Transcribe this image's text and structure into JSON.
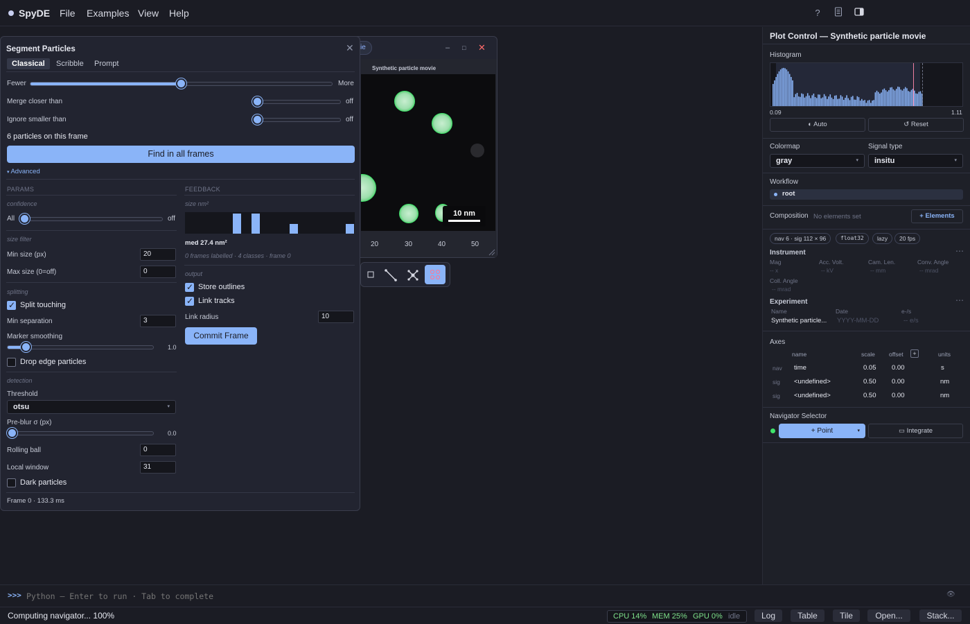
{
  "app": {
    "name": "SpyDE"
  },
  "menu": {
    "file": "File",
    "examples": "Examples",
    "view": "View",
    "help": "Help"
  },
  "topbar_icons": [
    "help-icon",
    "document-icon",
    "panel-toggle-icon"
  ],
  "plot_window": {
    "tab_label": "ie",
    "plot_title": "Synthetic particle movie",
    "scalebar_label": "10 nm",
    "x_ticks": [
      "20",
      "30",
      "40",
      "50"
    ],
    "minimize": "–",
    "maximize": "□",
    "close": "✕"
  },
  "plot_toolbar": {
    "tools": [
      "rectangle-tool-icon",
      "line-tool-icon",
      "move-points-tool-icon",
      "segment-tool-icon"
    ],
    "active": "segment-tool-icon"
  },
  "segment": {
    "title": "Segment Particles",
    "tabs": [
      {
        "label": "Classical",
        "active": true
      },
      {
        "label": "Scribble"
      },
      {
        "label": "Prompt"
      }
    ],
    "fewer": "Fewer",
    "more": "More",
    "sensitivity": 0.5,
    "merge_label": "Merge closer than",
    "merge_value": "off",
    "ignore_label": "Ignore smaller than",
    "ignore_value": "off",
    "particle_count": "6 particles on this frame",
    "find_all": "Find in all frames",
    "advanced": "Advanced",
    "params_head": "PARAMS",
    "feedback_head": "FEEDBACK",
    "confidence": {
      "label": "confidence",
      "min_label": "All",
      "value": "off"
    },
    "size_filter": {
      "label": "size filter",
      "min_label": "Min size (px)",
      "min_value": "20",
      "max_label": "Max size (0=off)",
      "max_value": "0"
    },
    "splitting": {
      "label": "splitting",
      "split_touching": "Split touching",
      "split_checked": true,
      "min_sep_label": "Min separation",
      "min_sep_value": "3",
      "marker_label": "Marker smoothing",
      "marker_value": "1.0",
      "drop_edge": "Drop edge particles",
      "drop_checked": false
    },
    "detection": {
      "label": "detection",
      "threshold_label": "Threshold",
      "threshold_value": "otsu",
      "preblur_label": "Pre-blur σ (px)",
      "preblur_value": "0.0",
      "rolling_label": "Rolling ball",
      "rolling_value": "0",
      "local_label": "Local window",
      "local_value": "31",
      "dark_label": "Dark particles",
      "dark_checked": false
    },
    "feedback": {
      "size_label": "size nm²",
      "histogram_bars": [
        0.95,
        0.95,
        0.45,
        0.45
      ],
      "median": "med 27.4 nm²",
      "summary": "0 frames labelled · 4 classes · frame 0",
      "output_label": "output",
      "store_outlines": "Store outlines",
      "link_tracks": "Link tracks",
      "link_radius_label": "Link radius",
      "link_radius_value": "10",
      "commit": "Commit Frame"
    },
    "frame_info": "Frame 0 · 133.3 ms"
  },
  "right_panel": {
    "title": "Plot Control — Synthetic particle movie",
    "histogram_label": "Histogram",
    "hist_min": "0.09",
    "hist_max": "1.11",
    "auto": "Auto",
    "reset": "Reset",
    "colormap_label": "Colormap",
    "colormap_value": "gray",
    "signal_label": "Signal type",
    "signal_value": "insitu",
    "workflow_label": "Workflow",
    "workflow_root": "root",
    "composition_label": "Composition",
    "composition_empty": "No elements set",
    "elements_btn": "+ Elements",
    "chips": [
      "nav 6 · sig 112 × 96",
      "float32",
      "lazy",
      "20 fps"
    ],
    "instrument": {
      "label": "Instrument",
      "fields": [
        {
          "name": "Mag",
          "value": "-- x"
        },
        {
          "name": "Acc. Volt.",
          "value": "-- kV"
        },
        {
          "name": "Cam. Len.",
          "value": "-- mm"
        },
        {
          "name": "Conv. Angle",
          "value": "-- mrad"
        },
        {
          "name": "Coll. Angle",
          "value": "-- mrad"
        }
      ]
    },
    "experiment": {
      "label": "Experiment",
      "fields": [
        {
          "name": "Name",
          "value": "Synthetic particle..."
        },
        {
          "name": "Date",
          "value": "YYYY-MM-DD"
        },
        {
          "name": "e-/s",
          "value": "-- e/s"
        }
      ]
    },
    "axes": {
      "label": "Axes",
      "headers": [
        "name",
        "scale",
        "offset",
        "units"
      ],
      "rows": [
        {
          "kind": "nav",
          "name": "time",
          "scale": "0.05",
          "offset": "0.00",
          "units": "s"
        },
        {
          "kind": "sig",
          "name": "<undefined>",
          "scale": "0.50",
          "offset": "0.00",
          "units": "nm"
        },
        {
          "kind": "sig",
          "name": "<undefined>",
          "scale": "0.50",
          "offset": "0.00",
          "units": "nm"
        }
      ]
    },
    "navigator_label": "Navigator Selector",
    "point": "+ Point",
    "integrate": "Integrate"
  },
  "console": {
    "prompt": ">>>",
    "placeholder": "Python — Enter to run · Tab to complete"
  },
  "status": {
    "message": "Computing navigator... 100%",
    "cpu": "CPU 14%",
    "mem": "MEM 25%",
    "gpu": "GPU 0%",
    "state": "idle",
    "buttons": [
      "Log",
      "Table",
      "Tile",
      "Open...",
      "Stack..."
    ]
  },
  "colors": {
    "accent": "#8ab4f8",
    "particle_outline": "#3fe36a",
    "close_red": "#ff6b6b",
    "status_green": "#7ee08a"
  }
}
